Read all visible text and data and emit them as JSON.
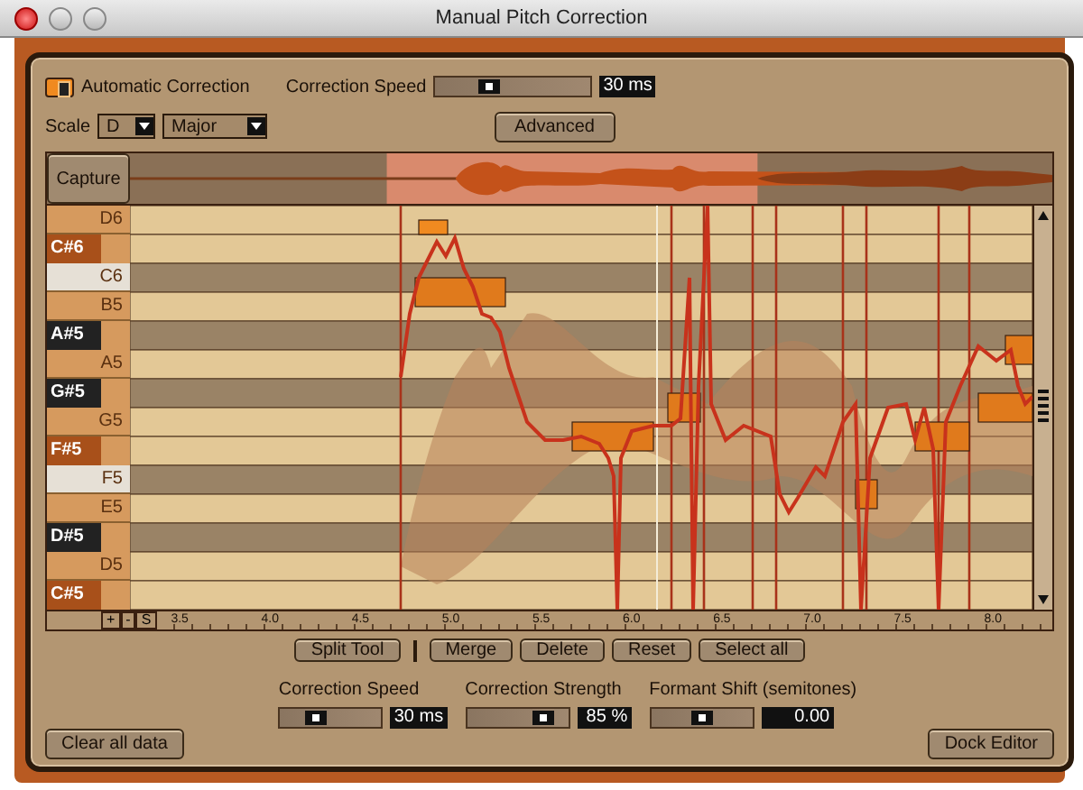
{
  "window": {
    "title": "Manual Pitch Correction"
  },
  "auto_correction": {
    "label": "Automatic Correction",
    "on": true
  },
  "top_speed": {
    "label": "Correction Speed",
    "level": 0.35,
    "reading": "30 ms"
  },
  "scale": {
    "label": "Scale",
    "key": "D",
    "mode": "Major"
  },
  "advanced_button": "Advanced",
  "capture_button": "Capture",
  "piano_keys": [
    {
      "name": "D6",
      "kind": "white",
      "in_scale": true
    },
    {
      "name": "C#6",
      "kind": "black",
      "in_scale": true
    },
    {
      "name": "C6",
      "kind": "white",
      "in_scale": false
    },
    {
      "name": "B5",
      "kind": "white",
      "in_scale": true
    },
    {
      "name": "A#5",
      "kind": "black",
      "in_scale": false
    },
    {
      "name": "A5",
      "kind": "white",
      "in_scale": true
    },
    {
      "name": "G#5",
      "kind": "black",
      "in_scale": false
    },
    {
      "name": "G5",
      "kind": "white",
      "in_scale": true
    },
    {
      "name": "F#5",
      "kind": "black",
      "in_scale": true
    },
    {
      "name": "F5",
      "kind": "white",
      "in_scale": false
    },
    {
      "name": "E5",
      "kind": "white",
      "in_scale": true
    },
    {
      "name": "D#5",
      "kind": "black",
      "in_scale": false
    },
    {
      "name": "D5",
      "kind": "white",
      "in_scale": true
    },
    {
      "name": "C#5",
      "kind": "black",
      "in_scale": true
    }
  ],
  "zoom_buttons": [
    "+",
    "-",
    "S"
  ],
  "ruler_labels": [
    "3.5",
    "4.0",
    "4.5",
    "5.0",
    "5.5",
    "6.0",
    "6.5",
    "7.0",
    "7.5",
    "8.0"
  ],
  "edit_buttons": [
    "Split Tool",
    "Merge",
    "Delete",
    "Reset",
    "Select all"
  ],
  "sliders": [
    {
      "label": "Correction Speed",
      "level": 0.35,
      "reading": "30 ms"
    },
    {
      "label": "Correction Strength",
      "level": 0.75,
      "reading": "85 %"
    },
    {
      "label": "Formant Shift (semitones)",
      "level": 0.5,
      "reading": "0.00"
    }
  ],
  "clear_button": "Clear all data",
  "dock_button": "Dock Editor"
}
